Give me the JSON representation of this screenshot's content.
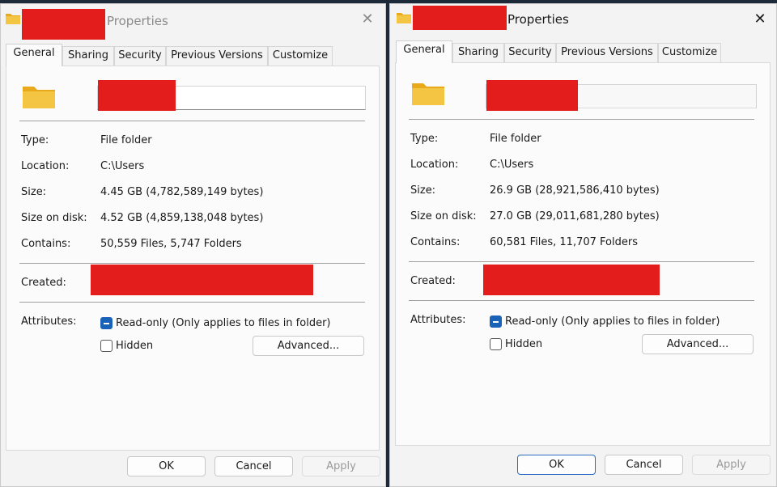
{
  "windows": [
    {
      "title": "Properties",
      "close": "✕",
      "tabs": [
        "General",
        "Sharing",
        "Security",
        "Previous Versions",
        "Customize"
      ],
      "fields": {
        "type_label": "Type:",
        "type_value": "File folder",
        "location_label": "Location:",
        "location_value": "C:\\Users",
        "size_label": "Size:",
        "size_value": "4.45 GB (4,782,589,149 bytes)",
        "size_on_disk_label": "Size on disk:",
        "size_on_disk_value": "4.52 GB (4,859,138,048 bytes)",
        "contains_label": "Contains:",
        "contains_value": "50,559 Files, 5,747 Folders",
        "created_label": "Created:",
        "attributes_label": "Attributes:"
      },
      "readonly_label": "Read-only (Only applies to files in folder)",
      "hidden_label": "Hidden",
      "advanced_label": "Advanced...",
      "buttons": {
        "ok": "OK",
        "cancel": "Cancel",
        "apply": "Apply"
      }
    },
    {
      "title": "Properties",
      "close": "✕",
      "tabs": [
        "General",
        "Sharing",
        "Security",
        "Previous Versions",
        "Customize"
      ],
      "fields": {
        "type_label": "Type:",
        "type_value": "File folder",
        "location_label": "Location:",
        "location_value": "C:\\Users",
        "size_label": "Size:",
        "size_value": "26.9 GB (28,921,586,410 bytes)",
        "size_on_disk_label": "Size on disk:",
        "size_on_disk_value": "27.0 GB (29,011,681,280 bytes)",
        "contains_label": "Contains:",
        "contains_value": "60,581 Files, 11,707 Folders",
        "created_label": "Created:",
        "attributes_label": "Attributes:"
      },
      "readonly_label": "Read-only (Only applies to files in folder)",
      "hidden_label": "Hidden",
      "advanced_label": "Advanced...",
      "buttons": {
        "ok": "OK",
        "cancel": "Cancel",
        "apply": "Apply"
      }
    }
  ],
  "colors": {
    "redaction": "#e31c1c",
    "checkbox_accent": "#1a62b8",
    "folder_yellow": "#f4c542"
  }
}
